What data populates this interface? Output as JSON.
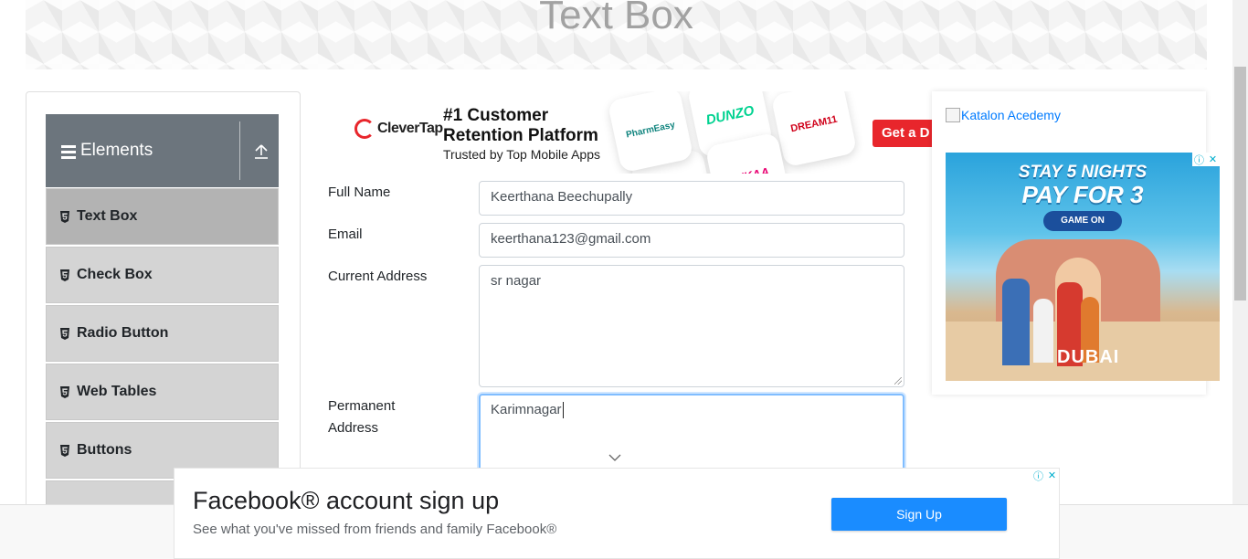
{
  "header": {
    "title": "Text Box"
  },
  "sidebar": {
    "group": {
      "label": "Elements",
      "icon": "hamburger-icon",
      "toggle_icon": "upload-arrow-icon"
    },
    "items": [
      {
        "label": "Text Box",
        "active": true
      },
      {
        "label": "Check Box",
        "active": false
      },
      {
        "label": "Radio Button",
        "active": false
      },
      {
        "label": "Web Tables",
        "active": false
      },
      {
        "label": "Buttons",
        "active": false
      }
    ]
  },
  "top_ad": {
    "brand": "CleverTap",
    "headline_1": "#1 Customer",
    "headline_2": "Retention Platform",
    "subline": "Trusted by Top Mobile Apps",
    "apps": [
      "PharmEasy",
      "DUNZO",
      "DREAM11",
      "NYKAA"
    ],
    "cta": "Get a D"
  },
  "form": {
    "full_name": {
      "label": "Full Name",
      "value": "Keerthana Beechupally"
    },
    "email": {
      "label": "Email",
      "value": "keerthana123@gmail.com"
    },
    "current_address": {
      "label": "Current Address",
      "value": "sr nagar"
    },
    "permanent_address": {
      "label_1": "Permanent",
      "label_2": "Address",
      "value": "Karimnagar"
    }
  },
  "side_ad": {
    "link_text": "Katalon Acedemy",
    "headline_1": "STAY 5 NIGHTS",
    "headline_2": "PAY FOR 3",
    "button": "GAME ON",
    "logo": "DUBAI"
  },
  "bottom_ad": {
    "title": "Facebook® account sign up",
    "description": "See what you've missed from friends and family Facebook®",
    "button": "Sign Up"
  },
  "colors": {
    "group_header": "#6c757d",
    "menu_item": "#d4d4d4",
    "menu_item_active": "#b3b3b3",
    "focus_border": "#80bdff",
    "link": "#007bff",
    "cta_red": "#e8262c",
    "fb_button": "#1a8cff"
  }
}
